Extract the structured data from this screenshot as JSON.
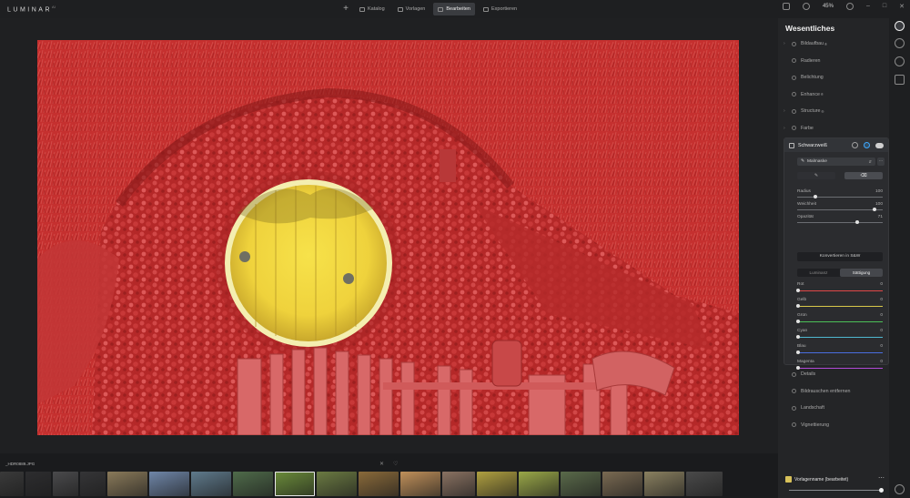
{
  "app": {
    "logo": "LUMINAR",
    "version": "AI"
  },
  "topnav": {
    "tabs": [
      {
        "label": "Katalog",
        "icon": "folder-icon",
        "active": false
      },
      {
        "label": "Vorlagen",
        "icon": "presets-icon",
        "active": false
      },
      {
        "label": "Bearbeiten",
        "icon": "edit-icon",
        "active": true
      },
      {
        "label": "Exportieren",
        "icon": "export-icon",
        "active": false
      }
    ]
  },
  "topright": {
    "zoom": "45%"
  },
  "panel": {
    "title": "Wesentliches",
    "tools_top": [
      {
        "label": "Bildaufbau",
        "suffix": "®",
        "icon": "composition-icon",
        "chevron": true
      },
      {
        "label": "Radieren",
        "icon": "erase-icon",
        "chevron": false
      },
      {
        "label": "Belichtung",
        "icon": "light-icon",
        "chevron": false
      },
      {
        "label": "Enhance",
        "suffix": "®",
        "icon": "enhance-icon",
        "chevron": false
      },
      {
        "label": "Structure",
        "suffix": "®",
        "icon": "structure-icon",
        "chevron": true
      },
      {
        "label": "Farbe",
        "icon": "color-icon",
        "chevron": true
      }
    ],
    "active_tool": {
      "title": "Schwarzweiß",
      "mask_mode": "Malmaske",
      "brush_paint": "✎",
      "brush_erase": "⌫",
      "sliders": [
        {
          "label": "Radius",
          "value": "100",
          "fraction": 0.2
        },
        {
          "label": "Weichheit",
          "value": "100",
          "fraction": 0.92
        },
        {
          "label": "Opazität",
          "value": "71",
          "fraction": 0.71
        }
      ],
      "convert_button": "Konvertieren in S&W",
      "segments": [
        "Luminanz",
        "Sättigung"
      ],
      "active_segment": 1,
      "color_sliders": [
        {
          "label": "Rot",
          "value": "0",
          "color": "#e04848"
        },
        {
          "label": "Gelb",
          "value": "0",
          "color": "#d8c84a"
        },
        {
          "label": "Grün",
          "value": "0",
          "color": "#4cbf58"
        },
        {
          "label": "Cyan",
          "value": "0",
          "color": "#4fb8d0"
        },
        {
          "label": "Blau",
          "value": "0",
          "color": "#4a6ee0"
        },
        {
          "label": "Magenta",
          "value": "0",
          "color": "#b24ad8"
        }
      ]
    },
    "tools_bottom": [
      {
        "label": "Details",
        "icon": "details-icon"
      },
      {
        "label": "Bildrauschen entfernen",
        "icon": "denoise-icon"
      },
      {
        "label": "Landschaft",
        "icon": "landscape-icon"
      },
      {
        "label": "Vignettierung",
        "icon": "vignette-icon"
      }
    ]
  },
  "filmstrip": {
    "filename": "_HDR0889.JPG",
    "selected_index": 8,
    "thumbs": [
      {
        "w": 26,
        "c": "#3a3a3a"
      },
      {
        "w": 28,
        "c": "#2d2d2f"
      },
      {
        "w": 28,
        "c": "#4a4a4c"
      },
      {
        "w": 28,
        "c": "#353537"
      },
      {
        "w": 44,
        "c": "#8a7a5a"
      },
      {
        "w": 44,
        "c": "#6f86a8"
      },
      {
        "w": 44,
        "c": "#5f7a8c"
      },
      {
        "w": 44,
        "c": "#4f6b4a"
      },
      {
        "w": 44,
        "c": "#6b8c3a"
      },
      {
        "w": 44,
        "c": "#6b7a42"
      },
      {
        "w": 44,
        "c": "#8a6a3a"
      },
      {
        "w": 44,
        "c": "#c0905a"
      },
      {
        "w": 36,
        "c": "#8a7262"
      },
      {
        "w": 44,
        "c": "#b0a040"
      },
      {
        "w": 44,
        "c": "#9aa848"
      },
      {
        "w": 44,
        "c": "#5a6a4a"
      },
      {
        "w": 44,
        "c": "#7a6a52"
      },
      {
        "w": 44,
        "c": "#8a8060"
      },
      {
        "w": 40,
        "c": "#4a4a4a"
      }
    ]
  },
  "preset": {
    "name": "Vorlagenname (bearbeitet)"
  }
}
